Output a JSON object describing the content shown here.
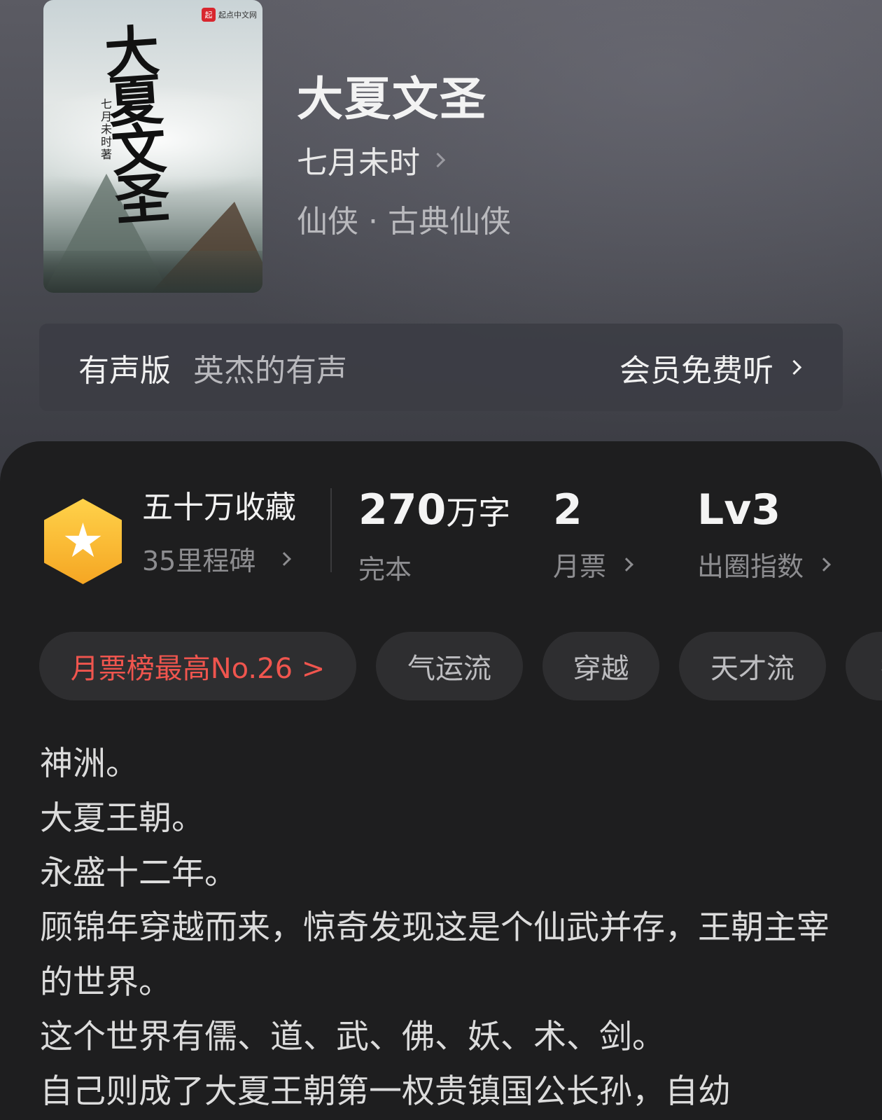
{
  "cover": {
    "publisher": "起点中文网",
    "publisher_mark": "起",
    "title_art": "大夏文圣",
    "author_art": "七月未时著"
  },
  "book": {
    "title": "大夏文圣",
    "author": "七月未时",
    "genre": "仙侠 · 古典仙侠"
  },
  "audio": {
    "label": "有声版",
    "narrator": "英杰的有声",
    "vip_action": "会员免费听"
  },
  "stats": {
    "collection_title": "五十万收藏",
    "milestone": "35里程碑",
    "word_count_number": "270",
    "word_count_unit": "万字",
    "status": "完本",
    "monthly_tickets_value": "2",
    "monthly_tickets_label": "月票",
    "level_value": "Lv3",
    "level_label": "出圈指数"
  },
  "tags": {
    "rank": "月票榜最高No.26 >",
    "items": [
      "气运流",
      "穿越",
      "天才流",
      "技"
    ]
  },
  "description": [
    "神洲。",
    "大夏王朝。",
    "永盛十二年。",
    "顾锦年穿越而来，惊奇发现这是个仙武并存，王朝主宰的世界。",
    "这个世界有儒、道、武、佛、妖、术、剑。",
    "自己则成了大夏王朝第一权贵镇国公长孙，自幼"
  ],
  "colors": {
    "rank_red": "#f0554e",
    "badge_gold": "#f5a623",
    "panel_bg": "#1e1e1f"
  }
}
